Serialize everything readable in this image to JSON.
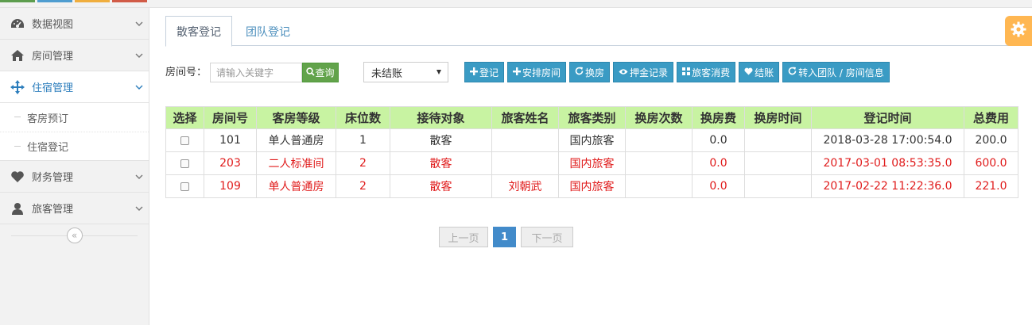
{
  "colors": {
    "accent": "#2b7dbc",
    "header_green": "#c8f3a2",
    "button_blue": "#3a9bc4",
    "search_green": "#62a34b",
    "highlight_red": "#e01b1b",
    "gear_orange": "#ffb752"
  },
  "sidebar": {
    "items": [
      {
        "label": "数据视图",
        "icon": "dashboard-icon"
      },
      {
        "label": "房间管理",
        "icon": "home-icon"
      },
      {
        "label": "住宿管理",
        "icon": "move-arrows-icon",
        "active": true
      },
      {
        "label": "财务管理",
        "icon": "heart-icon"
      },
      {
        "label": "旅客管理",
        "icon": "user-icon"
      }
    ],
    "submenu": [
      {
        "label": "客房预订"
      },
      {
        "label": "住宿登记"
      }
    ],
    "collapse_symbol": "«"
  },
  "tabs": [
    {
      "label": "散客登记",
      "active": true
    },
    {
      "label": "团队登记",
      "active": false
    }
  ],
  "toolbar": {
    "room_label": "房间号：",
    "search_placeholder": "请输入关键字",
    "search_button": "查询",
    "status_select": "未结账",
    "buttons": [
      {
        "icon": "plus",
        "label": "登记"
      },
      {
        "icon": "plus",
        "label": "安排房间"
      },
      {
        "icon": "refresh",
        "label": "换房"
      },
      {
        "icon": "eye",
        "label": "押金记录"
      },
      {
        "icon": "grid",
        "label": "旅客消费"
      },
      {
        "icon": "heart",
        "label": "结账"
      },
      {
        "icon": "refresh",
        "label": "转入团队 / 房间信息"
      }
    ]
  },
  "table": {
    "headers": [
      "选择",
      "房间号",
      "客房等级",
      "床位数",
      "接待对象",
      "旅客姓名",
      "旅客类别",
      "换房次数",
      "换房费",
      "换房时间",
      "登记时间",
      "总费用"
    ],
    "rows": [
      {
        "red": false,
        "cells": [
          "",
          "101",
          "单人普通房",
          "1",
          "散客",
          "",
          "国内旅客",
          "",
          "0.0",
          "",
          "2018-03-28 17:00:54.0",
          "200.0"
        ]
      },
      {
        "red": true,
        "cells": [
          "",
          "203",
          "二人标准间",
          "2",
          "散客",
          "",
          "国内旅客",
          "",
          "0.0",
          "",
          "2017-03-01 08:53:35.0",
          "600.0"
        ]
      },
      {
        "red": true,
        "cells": [
          "",
          "109",
          "单人普通房",
          "2",
          "散客",
          "刘朝武",
          "国内旅客",
          "",
          "0.0",
          "",
          "2017-02-22 11:22:36.0",
          "221.0"
        ]
      }
    ]
  },
  "pagination": {
    "prev": "上一页",
    "current": "1",
    "next": "下一页"
  }
}
